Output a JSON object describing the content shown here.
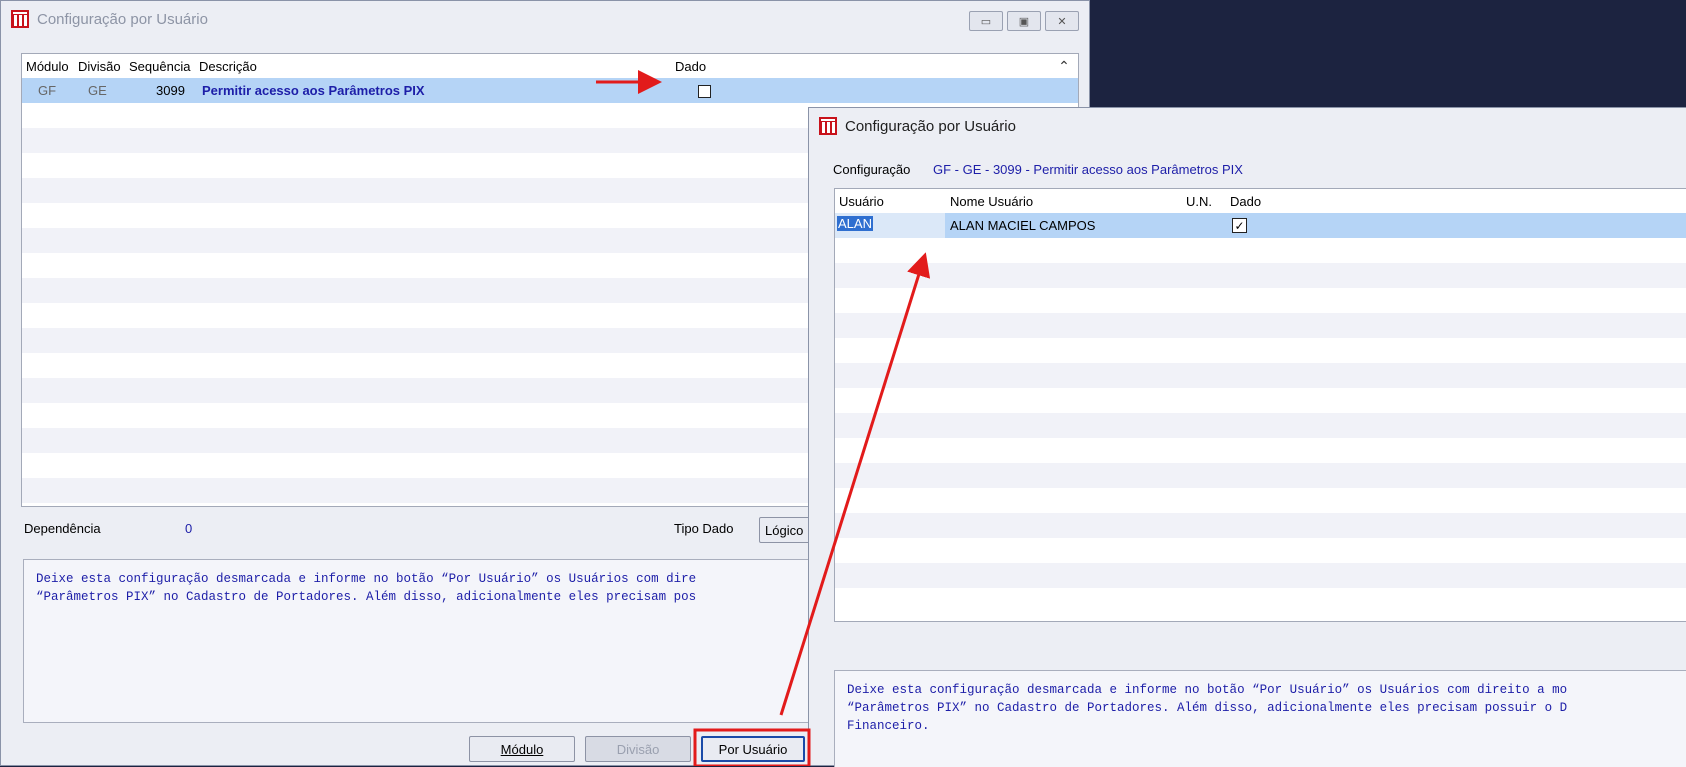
{
  "colors": {
    "desktop": "#1c2340",
    "selection": "#b5d4f6",
    "memo_text": "#1d1ea8",
    "annotation": "#e21b1b"
  },
  "window1": {
    "title": "Configuração por Usuário",
    "grid": {
      "headers": [
        "Módulo",
        "Divisão",
        "Sequência",
        "Descrição",
        "Dado"
      ],
      "row": {
        "modulo": "GF",
        "divisao": "GE",
        "sequencia": "3099",
        "descricao": "Permitir acesso aos Parâmetros PIX",
        "dado_checked": false
      }
    },
    "dependencia_label": "Dependência",
    "dependencia_value": "0",
    "tipo_dado_label": "Tipo Dado",
    "tipo_dado_value": "Lógico",
    "memo": "Deixe esta configuração desmarcada e informe no botão “Por Usuário” os Usuários com dire\n“Parâmetros PIX” no Cadastro de Portadores. Além disso, adicionalmente eles precisam pos",
    "buttons": {
      "modulo": "Módulo",
      "divisao": "Divisão",
      "por_usuario": "Por Usuário"
    }
  },
  "window2": {
    "title": "Configuração por Usuário",
    "config_label": "Configuração",
    "config_value": "GF - GE - 3099 - Permitir acesso aos Parâmetros PIX",
    "grid": {
      "headers": [
        "Usuário",
        "Nome Usuário",
        "U.N.",
        "Dado"
      ],
      "row": {
        "usuario": "ALAN",
        "nome": "ALAN MACIEL CAMPOS",
        "un": "",
        "dado_checked": true
      }
    },
    "memo": "Deixe esta configuração desmarcada e informe no botão “Por Usuário” os Usuários com direito a mo\n“Parâmetros PIX” no Cadastro de Portadores. Além disso, adicionalmente eles precisam possuir o D\nFinanceiro."
  },
  "icons": {
    "app": "app-logo-icon",
    "minimize": "minimize-icon",
    "maximize": "maximize-icon",
    "close": "close-icon",
    "scroll_up": "chevron-up-icon"
  }
}
